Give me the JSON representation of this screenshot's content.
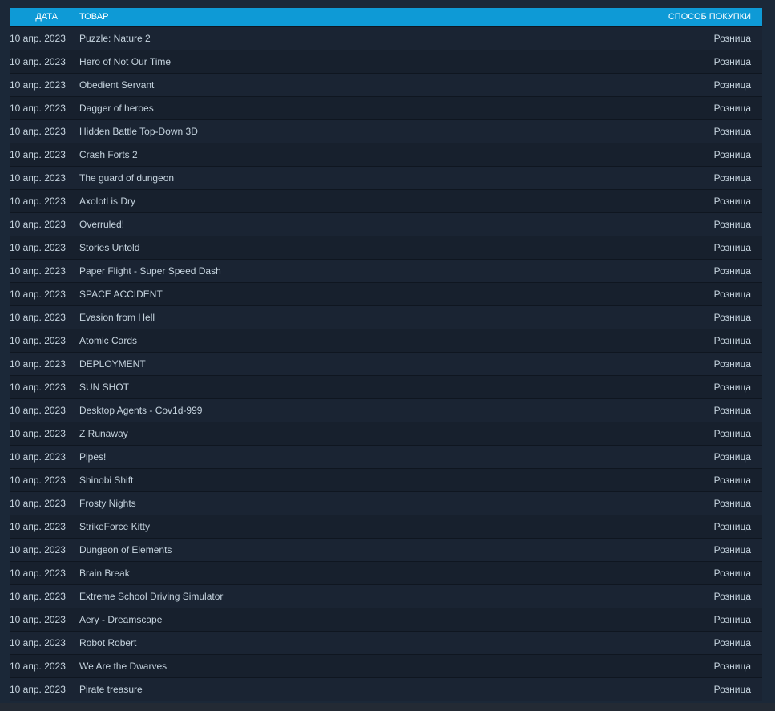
{
  "table": {
    "headers": {
      "date": "ДАТА",
      "item": "ТОВАР",
      "method": "СПОСОБ ПОКУПКИ"
    },
    "rows": [
      {
        "date": "10 апр. 2023",
        "item": "Puzzle: Nature 2",
        "method": "Розница"
      },
      {
        "date": "10 апр. 2023",
        "item": "Hero of Not Our Time",
        "method": "Розница"
      },
      {
        "date": "10 апр. 2023",
        "item": "Obedient Servant",
        "method": "Розница"
      },
      {
        "date": "10 апр. 2023",
        "item": "Dagger of heroes",
        "method": "Розница"
      },
      {
        "date": "10 апр. 2023",
        "item": "Hidden Battle Top-Down 3D",
        "method": "Розница"
      },
      {
        "date": "10 апр. 2023",
        "item": "Crash Forts 2",
        "method": "Розница"
      },
      {
        "date": "10 апр. 2023",
        "item": "The guard of dungeon",
        "method": "Розница"
      },
      {
        "date": "10 апр. 2023",
        "item": "Axolotl is Dry",
        "method": "Розница"
      },
      {
        "date": "10 апр. 2023",
        "item": "Overruled!",
        "method": "Розница"
      },
      {
        "date": "10 апр. 2023",
        "item": "Stories Untold",
        "method": "Розница"
      },
      {
        "date": "10 апр. 2023",
        "item": "Paper Flight - Super Speed Dash",
        "method": "Розница"
      },
      {
        "date": "10 апр. 2023",
        "item": "SPACE ACCIDENT",
        "method": "Розница"
      },
      {
        "date": "10 апр. 2023",
        "item": "Evasion from Hell",
        "method": "Розница"
      },
      {
        "date": "10 апр. 2023",
        "item": "Atomic Cards",
        "method": "Розница"
      },
      {
        "date": "10 апр. 2023",
        "item": "DEPLOYMENT",
        "method": "Розница"
      },
      {
        "date": "10 апр. 2023",
        "item": "SUN SHOT",
        "method": "Розница"
      },
      {
        "date": "10 апр. 2023",
        "item": "Desktop Agents - Cov1d-999",
        "method": "Розница"
      },
      {
        "date": "10 апр. 2023",
        "item": "Z Runaway",
        "method": "Розница"
      },
      {
        "date": "10 апр. 2023",
        "item": "Pipes!",
        "method": "Розница"
      },
      {
        "date": "10 апр. 2023",
        "item": "Shinobi Shift",
        "method": "Розница"
      },
      {
        "date": "10 апр. 2023",
        "item": "Frosty Nights",
        "method": "Розница"
      },
      {
        "date": "10 апр. 2023",
        "item": "StrikeForce Kitty",
        "method": "Розница"
      },
      {
        "date": "10 апр. 2023",
        "item": "Dungeon of Elements",
        "method": "Розница"
      },
      {
        "date": "10 апр. 2023",
        "item": "Brain Break",
        "method": "Розница"
      },
      {
        "date": "10 апр. 2023",
        "item": "Extreme School Driving Simulator",
        "method": "Розница"
      },
      {
        "date": "10 апр. 2023",
        "item": "Aery - Dreamscape",
        "method": "Розница"
      },
      {
        "date": "10 апр. 2023",
        "item": "Robot Robert",
        "method": "Розница"
      },
      {
        "date": "10 апр. 2023",
        "item": "We Are the Dwarves",
        "method": "Розница"
      },
      {
        "date": "10 апр. 2023",
        "item": "Pirate treasure",
        "method": "Розница"
      }
    ]
  },
  "colors": {
    "header_bg": "#0e9ad6",
    "page_bg": "#1b2838",
    "row_text": "#c6d4df"
  }
}
